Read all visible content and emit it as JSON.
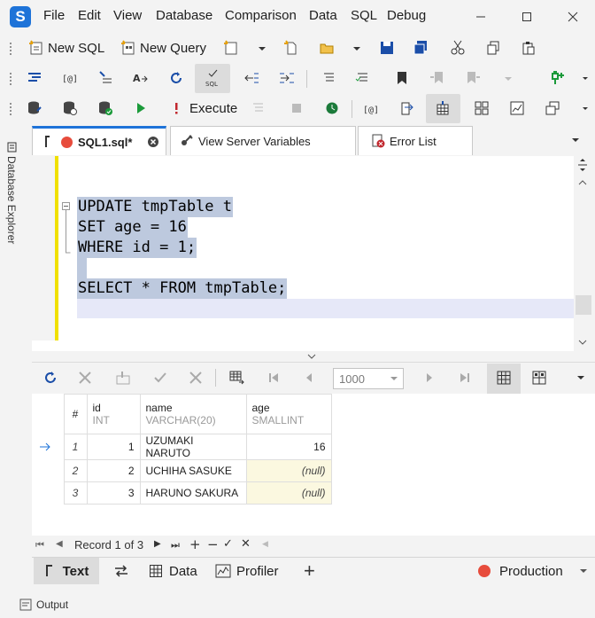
{
  "app": {
    "logo": "S"
  },
  "menu": [
    "File",
    "Edit",
    "View",
    "Database",
    "Comparison",
    "Data",
    "SQL",
    "Debug"
  ],
  "toolbar": {
    "new_sql": "New SQL",
    "new_query": "New Query",
    "execute": "Execute"
  },
  "sidebar": {
    "label": "Database Explorer"
  },
  "tabs": [
    {
      "label": "SQL1.sql*",
      "active": true
    },
    {
      "label": "View Server Variables"
    },
    {
      "label": "Error List"
    }
  ],
  "editor": {
    "lines": [
      "UPDATE tmpTable t",
      "SET age = 16",
      "WHERE id = 1;",
      "SELECT * FROM tmpTable;"
    ]
  },
  "grid_toolbar": {
    "row_limit": "1000"
  },
  "grid": {
    "columns": [
      {
        "name": "#",
        "type": ""
      },
      {
        "name": "id",
        "type": "INT"
      },
      {
        "name": "name",
        "type": "VARCHAR(20)"
      },
      {
        "name": "age",
        "type": "SMALLINT"
      }
    ],
    "rows": [
      {
        "rn": "1",
        "id": "1",
        "name": "UZUMAKI NARUTO",
        "age": "16"
      },
      {
        "rn": "2",
        "id": "2",
        "name": "UCHIHA SASUKE",
        "age": "(null)"
      },
      {
        "rn": "3",
        "id": "3",
        "name": "HARUNO SAKURA",
        "age": "(null)"
      }
    ]
  },
  "record_bar": {
    "text": "Record 1 of 3"
  },
  "bottom_tabs": {
    "text": "Text",
    "data": "Data",
    "profiler": "Profiler",
    "connection": "Production"
  },
  "output": {
    "label": "Output"
  },
  "colors": {
    "accent": "#1e73d8",
    "current_line": "#e6e8f8",
    "selection": "#bdc9de",
    "gutter": "#f0e000",
    "null_cell": "#fbf8e0",
    "connection": "#e74c3c"
  }
}
